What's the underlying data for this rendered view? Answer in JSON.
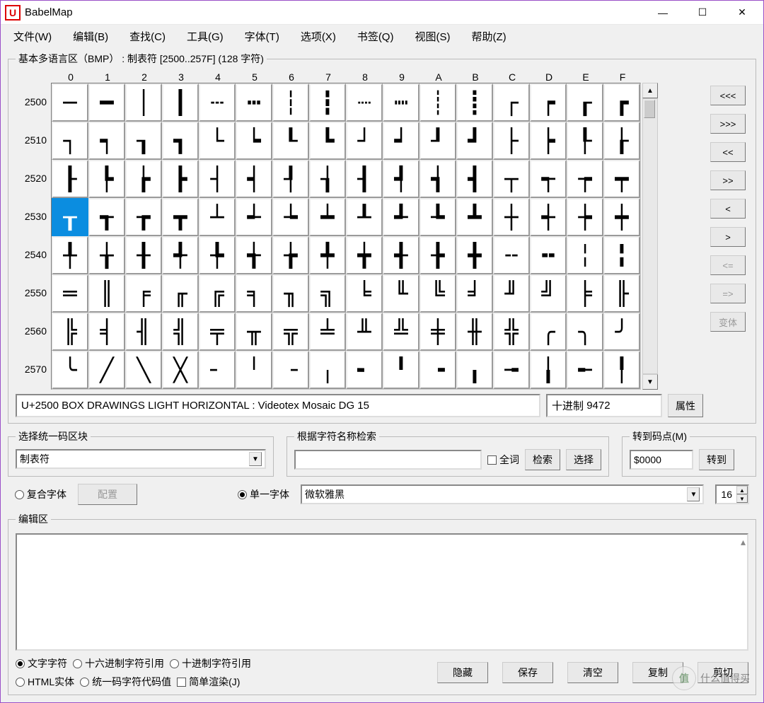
{
  "window": {
    "title": "BabelMap",
    "app_icon_letter": "U"
  },
  "menu": [
    "文件(W)",
    "编辑(B)",
    "查找(C)",
    "工具(G)",
    "字体(T)",
    "选项(X)",
    "书签(Q)",
    "视图(S)",
    "帮助(Z)"
  ],
  "glyph_group": {
    "legend": "基本多语言区（BMP） : 制表符 [2500..257F] (128 字符)",
    "col_headers": [
      "0",
      "1",
      "2",
      "3",
      "4",
      "5",
      "6",
      "7",
      "8",
      "9",
      "A",
      "B",
      "C",
      "D",
      "E",
      "F"
    ],
    "row_labels": [
      "2500",
      "2510",
      "2520",
      "2530",
      "2540",
      "2550",
      "2560",
      "2570"
    ],
    "rows": [
      [
        "─",
        "━",
        "│",
        "┃",
        "┄",
        "┅",
        "┆",
        "┇",
        "┈",
        "┉",
        "┊",
        "┋",
        "┌",
        "┍",
        "┎",
        "┏"
      ],
      [
        "┐",
        "┑",
        "┒",
        "┓",
        "└",
        "┕",
        "┖",
        "┗",
        "┘",
        "┙",
        "┚",
        "┛",
        "├",
        "┝",
        "┞",
        "┟"
      ],
      [
        "┠",
        "┡",
        "┢",
        "┣",
        "┤",
        "┥",
        "┦",
        "┧",
        "┨",
        "┩",
        "┪",
        "┫",
        "┬",
        "┭",
        "┮",
        "┯"
      ],
      [
        "┰",
        "┱",
        "┲",
        "┳",
        "┴",
        "┵",
        "┶",
        "┷",
        "┸",
        "┹",
        "┺",
        "┻",
        "┼",
        "┽",
        "┾",
        "┿"
      ],
      [
        "╀",
        "╁",
        "╂",
        "╃",
        "╄",
        "╅",
        "╆",
        "╇",
        "╈",
        "╉",
        "╊",
        "╋",
        "╌",
        "╍",
        "╎",
        "╏"
      ],
      [
        "═",
        "║",
        "╒",
        "╓",
        "╔",
        "╕",
        "╖",
        "╗",
        "╘",
        "╙",
        "╚",
        "╛",
        "╜",
        "╝",
        "╞",
        "╟"
      ],
      [
        "╠",
        "╡",
        "╢",
        "╣",
        "╤",
        "╥",
        "╦",
        "╧",
        "╨",
        "╩",
        "╪",
        "╫",
        "╬",
        "╭",
        "╮",
        "╯"
      ],
      [
        "╰",
        "╱",
        "╲",
        "╳",
        "╴",
        "╵",
        "╶",
        "╷",
        "╸",
        "╹",
        "╺",
        "╻",
        "╼",
        "╽",
        "╾",
        "╿"
      ]
    ],
    "selected": {
      "row": 3,
      "col": 0
    },
    "nav_buttons": [
      "<<<",
      ">>>",
      "<<",
      ">>",
      "<",
      ">",
      "<=",
      "=>",
      "变体"
    ],
    "info_text": "U+2500 BOX DRAWINGS LIGHT HORIZONTAL : Videotex Mosaic DG 15",
    "decimal_label": "十进制",
    "decimal_value": "9472",
    "props_btn": "属性"
  },
  "block_select": {
    "legend": "选择统一码区块",
    "value": "制表符"
  },
  "name_search": {
    "legend": "根据字符名称检索",
    "value": "",
    "wholeword": "全词",
    "search_btn": "检索",
    "select_btn": "选择"
  },
  "goto": {
    "legend": "转到码点(M)",
    "value": "$0000",
    "btn": "转到"
  },
  "font_row": {
    "composite": "复合字体",
    "configure": "配置",
    "single": "单一字体",
    "font_value": "微软雅黑",
    "size": "16"
  },
  "edit_area": {
    "legend": "编辑区",
    "radios": [
      "文字字符",
      "十六进制字符引用",
      "十进制字符引用",
      "HTML实体",
      "统一码字符代码值"
    ],
    "simple_render": "简单渲染(J)",
    "buttons": [
      "隐藏",
      "保存",
      "清空",
      "复制",
      "剪切"
    ]
  },
  "watermark": {
    "badge": "值",
    "text": "什么值得买"
  }
}
